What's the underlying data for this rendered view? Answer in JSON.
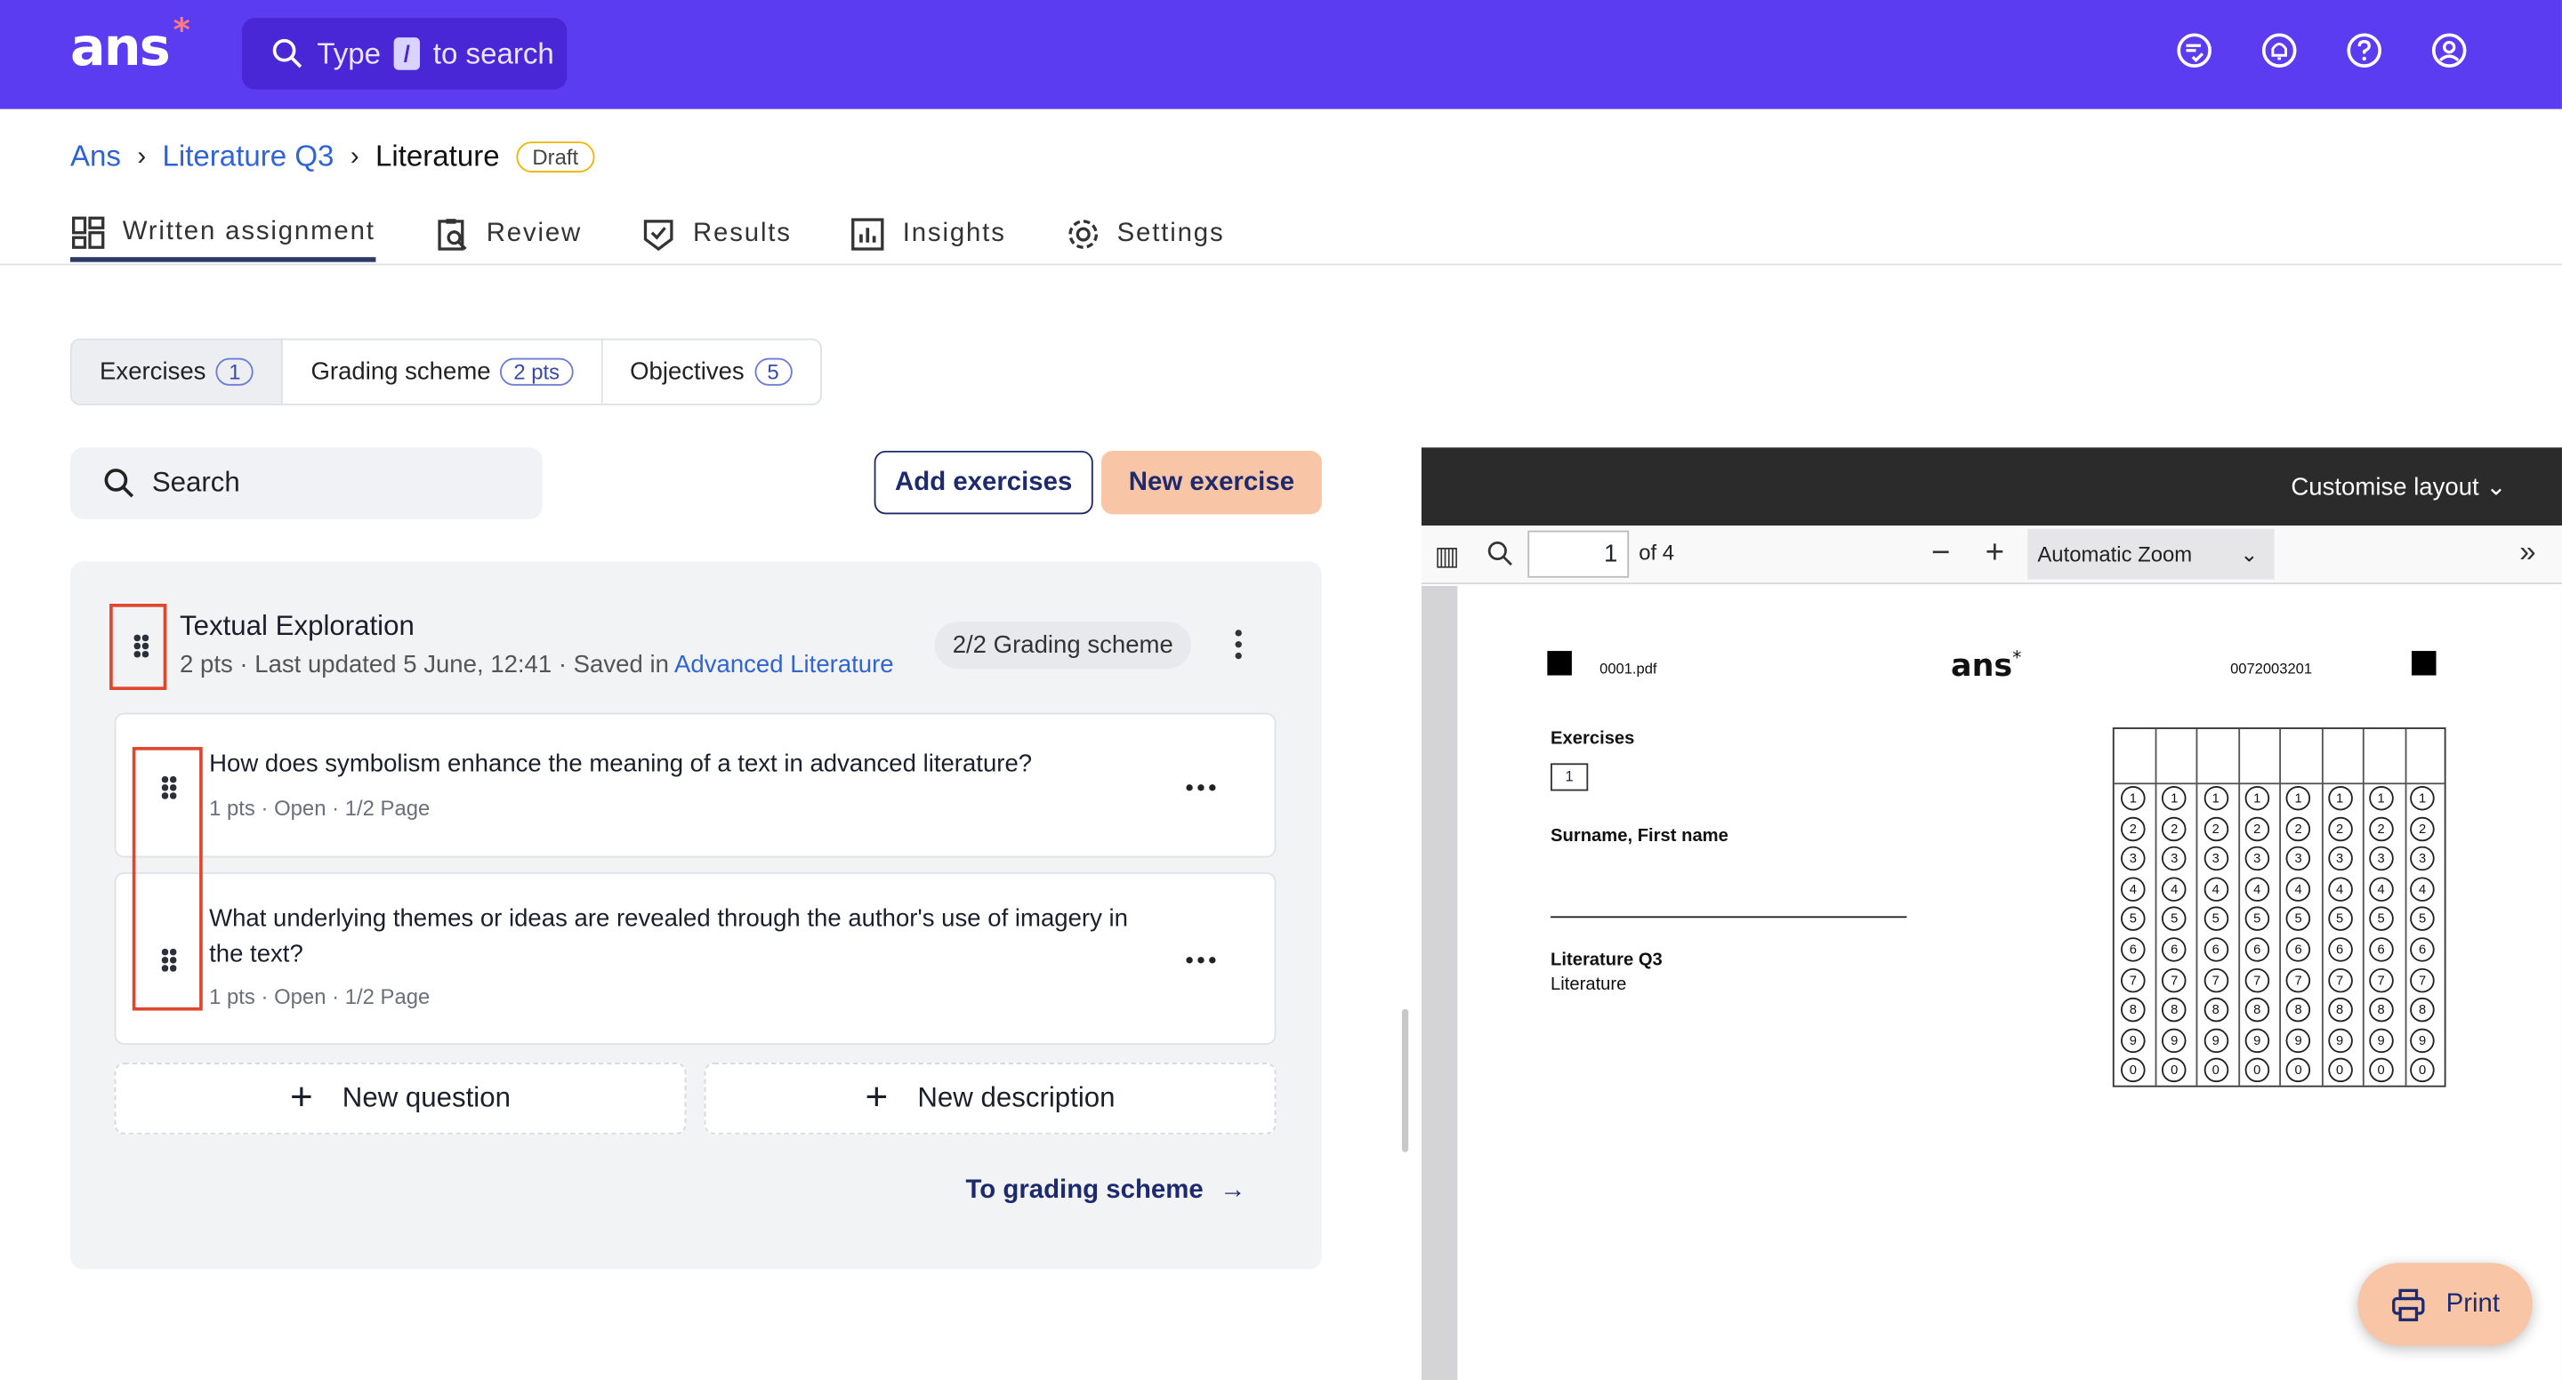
{
  "app": {
    "logo": "ans",
    "logo_mark": "*"
  },
  "topbar": {
    "search_prefix": "Type",
    "search_key": "/",
    "search_suffix": "to search",
    "icons": [
      "tasks-icon",
      "bell-icon",
      "help-icon",
      "account-icon"
    ]
  },
  "breadcrumb": {
    "items": [
      "Ans",
      "Literature Q3",
      "Literature"
    ],
    "status": "Draft"
  },
  "tabs": [
    {
      "label": "Written assignment",
      "icon": "layout-icon"
    },
    {
      "label": "Review",
      "icon": "review-icon"
    },
    {
      "label": "Results",
      "icon": "results-icon"
    },
    {
      "label": "Insights",
      "icon": "insights-icon"
    },
    {
      "label": "Settings",
      "icon": "gear-icon"
    }
  ],
  "subtabs": [
    {
      "label": "Exercises",
      "count": "1"
    },
    {
      "label": "Grading scheme",
      "count": "2 pts"
    },
    {
      "label": "Objectives",
      "count": "5"
    }
  ],
  "toolbar": {
    "search_placeholder": "Search",
    "add_label": "Add exercises",
    "new_label": "New exercise"
  },
  "exercise": {
    "title": "Textual Exploration",
    "meta": "2 pts · Last updated 5 June, 12:41 · Saved in",
    "saved_in": "Advanced Literature",
    "grading_pill": "2/2 Grading scheme",
    "questions": [
      {
        "text": "How does symbolism enhance the meaning of a text in advanced literature?",
        "meta": "1 pts · Open · 1/2 Page"
      },
      {
        "text": "What underlying themes or ideas are revealed through the author's use of imagery in the text?",
        "meta": "1 pts · Open · 1/2 Page"
      }
    ],
    "new_question": "New question",
    "new_description": "New description",
    "to_grading": "To grading scheme"
  },
  "pdf": {
    "customise": "Customise layout",
    "page": "1",
    "of": "of 4",
    "zoom": "Automatic Zoom",
    "filename": "0001.pdf",
    "code": "0072003201",
    "logo": "ans",
    "exercises_label": "Exercises",
    "exercise_box": "1",
    "name_label": "Surname, First name",
    "course": "Literature Q3",
    "course_sub": "Literature",
    "digits": [
      "1",
      "2",
      "3",
      "4",
      "5",
      "6",
      "7",
      "8",
      "9",
      "0"
    ]
  },
  "print_label": "Print",
  "colors": {
    "brand": "#5c3cf0",
    "accent": "#f8c6a6",
    "link": "#2f63d6",
    "highlight": "#e0452e"
  }
}
